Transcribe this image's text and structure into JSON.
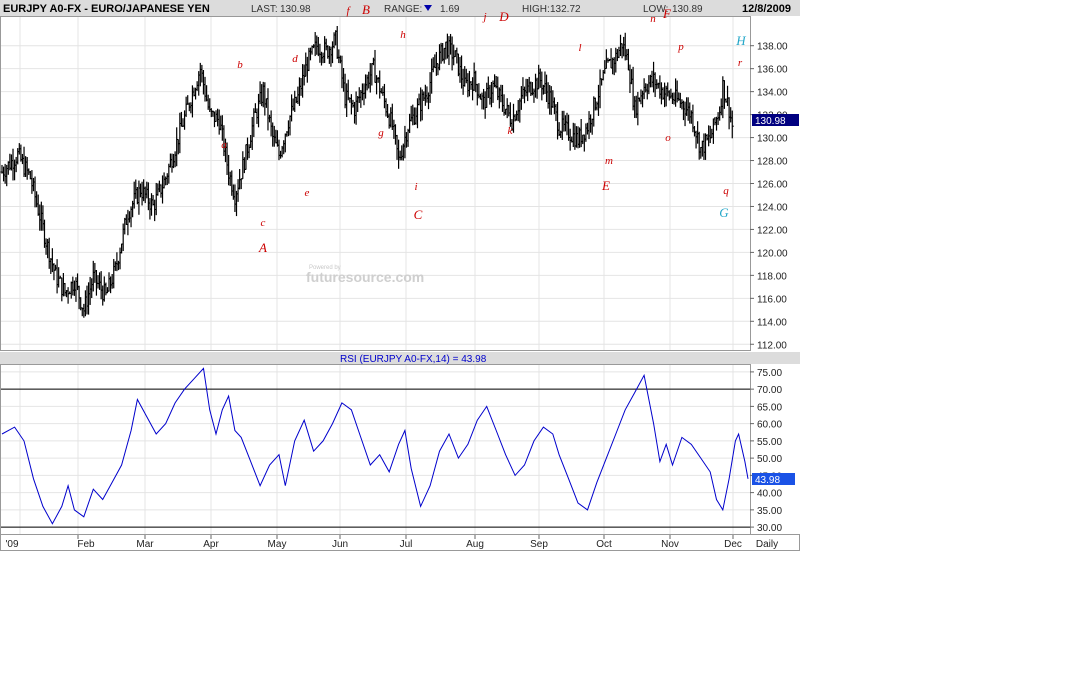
{
  "header": {
    "symbol": "EURJPY A0-FX - EURO/JAPANESE YEN",
    "last_label": "LAST:",
    "last_value": "130.98",
    "range_label": "RANGE:",
    "range_value": "1.69",
    "high_label": "HIGH:",
    "high_value": "132.72",
    "low_label": "LOW:",
    "low_value": "130.89",
    "date": "12/8/2009"
  },
  "watermark": "futuresource.com",
  "watermark_small": "Powered by",
  "rsi_title": "RSI (EURJPY A0-FX,14) = 43.98",
  "last_price_tag": "130.98",
  "rsi_tag": "43.98",
  "colors": {
    "header_bg": "#dcdcdc",
    "price_bars": "#000000",
    "rsi_line": "#0000cc",
    "tag_bg": "#000080",
    "rsi_tag_bg": "#1a52e6",
    "wave_red": "#cc0000",
    "wave_blue": "#22a6c8",
    "grid": "#dddddd"
  },
  "chart_data": [
    {
      "type": "ohlc",
      "title": "EURJPY A0-FX - EURO/JAPANESE YEN",
      "xlabel": "",
      "ylabel": "",
      "ylim": [
        111.5,
        140.5
      ],
      "y_ticks": [
        "112.00",
        "114.00",
        "116.00",
        "118.00",
        "120.00",
        "122.00",
        "124.00",
        "126.00",
        "128.00",
        "130.00",
        "132.00",
        "134.00",
        "136.00",
        "138.00"
      ],
      "x_ticks": [
        "'09",
        "Feb",
        "Mar",
        "Apr",
        "May",
        "Jun",
        "Jul",
        "Aug",
        "Sep",
        "Oct",
        "Nov",
        "Dec",
        "Daily"
      ],
      "grid": true,
      "series_close_path": [
        {
          "t": 0,
          "v": 127.0
        },
        {
          "t": 5,
          "v": 128.5
        },
        {
          "t": 9,
          "v": 126.5
        },
        {
          "t": 14,
          "v": 121
        },
        {
          "t": 17,
          "v": 118
        },
        {
          "t": 20,
          "v": 116.5
        },
        {
          "t": 23,
          "v": 117.5
        },
        {
          "t": 26,
          "v": 115.0
        },
        {
          "t": 29,
          "v": 117.8
        },
        {
          "t": 33,
          "v": 116.2
        },
        {
          "t": 36,
          "v": 118.5
        },
        {
          "t": 40,
          "v": 123.5
        },
        {
          "t": 44,
          "v": 125.5
        },
        {
          "t": 48,
          "v": 124.0
        },
        {
          "t": 52,
          "v": 126.5
        },
        {
          "t": 56,
          "v": 130.0
        },
        {
          "t": 60,
          "v": 133.5
        },
        {
          "t": 63,
          "v": 136.0
        },
        {
          "t": 66,
          "v": 132.0
        },
        {
          "t": 69,
          "v": 131.5
        },
        {
          "t": 72,
          "v": 127.0
        },
        {
          "t": 74,
          "v": 125.0
        },
        {
          "t": 77,
          "v": 128.0
        },
        {
          "t": 80,
          "v": 131.5
        },
        {
          "t": 83,
          "v": 134.0
        },
        {
          "t": 86,
          "v": 130.0
        },
        {
          "t": 88,
          "v": 128.5
        },
        {
          "t": 91,
          "v": 131.5
        },
        {
          "t": 94,
          "v": 133.5
        },
        {
          "t": 97,
          "v": 136.5
        },
        {
          "t": 100,
          "v": 138.0
        },
        {
          "t": 103,
          "v": 137.5
        },
        {
          "t": 106,
          "v": 138.5
        },
        {
          "t": 109,
          "v": 133.5
        },
        {
          "t": 112,
          "v": 132.5
        },
        {
          "t": 115,
          "v": 134.5
        },
        {
          "t": 118,
          "v": 136.0
        },
        {
          "t": 121,
          "v": 133.5
        },
        {
          "t": 124,
          "v": 131.0
        },
        {
          "t": 126,
          "v": 128.0
        },
        {
          "t": 129,
          "v": 131.0
        },
        {
          "t": 132,
          "v": 132.5
        },
        {
          "t": 135,
          "v": 134.0
        },
        {
          "t": 138,
          "v": 136.5
        },
        {
          "t": 141,
          "v": 138.0
        },
        {
          "t": 144,
          "v": 137.0
        },
        {
          "t": 147,
          "v": 134.5
        },
        {
          "t": 150,
          "v": 135.0
        },
        {
          "t": 153,
          "v": 133.0
        },
        {
          "t": 156,
          "v": 134.5
        },
        {
          "t": 159,
          "v": 133.0
        },
        {
          "t": 162,
          "v": 131.5
        },
        {
          "t": 165,
          "v": 133.5
        },
        {
          "t": 168,
          "v": 134.5
        },
        {
          "t": 171,
          "v": 135.0
        },
        {
          "t": 174,
          "v": 133.5
        },
        {
          "t": 177,
          "v": 131.0
        },
        {
          "t": 180,
          "v": 130.5
        },
        {
          "t": 183,
          "v": 129.8
        },
        {
          "t": 186,
          "v": 131.0
        },
        {
          "t": 189,
          "v": 133.5
        },
        {
          "t": 192,
          "v": 136.0
        },
        {
          "t": 195,
          "v": 137.0
        },
        {
          "t": 197,
          "v": 138.2
        },
        {
          "t": 199,
          "v": 136.5
        },
        {
          "t": 201,
          "v": 132.5
        },
        {
          "t": 204,
          "v": 134.5
        },
        {
          "t": 207,
          "v": 135.0
        },
        {
          "t": 210,
          "v": 134.0
        },
        {
          "t": 213,
          "v": 133.5
        },
        {
          "t": 216,
          "v": 133.0
        },
        {
          "t": 219,
          "v": 132.0
        },
        {
          "t": 222,
          "v": 129.0
        },
        {
          "t": 225,
          "v": 130.0
        },
        {
          "t": 228,
          "v": 132.5
        },
        {
          "t": 229,
          "v": 134.5
        },
        {
          "t": 231,
          "v": 132.5
        },
        {
          "t": 232,
          "v": 131.0
        }
      ],
      "wave_labels": [
        {
          "label": "a",
          "color": "red"
        },
        {
          "label": "b",
          "color": "red"
        },
        {
          "label": "c",
          "color": "red"
        },
        {
          "label": "A",
          "color": "red"
        },
        {
          "label": "d",
          "color": "red"
        },
        {
          "label": "e",
          "color": "red"
        },
        {
          "label": "f",
          "color": "red"
        },
        {
          "label": "B",
          "color": "red"
        },
        {
          "label": "g",
          "color": "red"
        },
        {
          "label": "h",
          "color": "red"
        },
        {
          "label": "i",
          "color": "red"
        },
        {
          "label": "C",
          "color": "red"
        },
        {
          "label": "j",
          "color": "red"
        },
        {
          "label": "D",
          "color": "red"
        },
        {
          "label": "k",
          "color": "red"
        },
        {
          "label": "l",
          "color": "red"
        },
        {
          "label": "m",
          "color": "red"
        },
        {
          "label": "E",
          "color": "red"
        },
        {
          "label": "n",
          "color": "red"
        },
        {
          "label": "F",
          "color": "red"
        },
        {
          "label": "o",
          "color": "red"
        },
        {
          "label": "p",
          "color": "red"
        },
        {
          "label": "q",
          "color": "red"
        },
        {
          "label": "r",
          "color": "red"
        },
        {
          "label": "G",
          "color": "blue"
        },
        {
          "label": "H",
          "color": "blue"
        }
      ]
    },
    {
      "type": "line",
      "title": "RSI (EURJPY A0-FX,14) = 43.98",
      "xlabel": "",
      "ylabel": "",
      "ylim": [
        28,
        77
      ],
      "y_ticks": [
        "30.00",
        "35.00",
        "40.00",
        "45.00",
        "50.00",
        "55.00",
        "60.00",
        "65.00",
        "70.00",
        "75.00"
      ],
      "reference_lines": [
        70,
        30
      ],
      "series": [
        {
          "values": [
            {
              "t": 0,
              "v": 57
            },
            {
              "t": 4,
              "v": 59
            },
            {
              "t": 7,
              "v": 55
            },
            {
              "t": 10,
              "v": 44
            },
            {
              "t": 13,
              "v": 36
            },
            {
              "t": 16,
              "v": 31
            },
            {
              "t": 19,
              "v": 36
            },
            {
              "t": 21,
              "v": 42
            },
            {
              "t": 23,
              "v": 35
            },
            {
              "t": 26,
              "v": 33
            },
            {
              "t": 29,
              "v": 41
            },
            {
              "t": 32,
              "v": 38
            },
            {
              "t": 35,
              "v": 43
            },
            {
              "t": 38,
              "v": 48
            },
            {
              "t": 41,
              "v": 58
            },
            {
              "t": 43,
              "v": 67
            },
            {
              "t": 46,
              "v": 62
            },
            {
              "t": 49,
              "v": 57
            },
            {
              "t": 52,
              "v": 60
            },
            {
              "t": 55,
              "v": 66
            },
            {
              "t": 58,
              "v": 70
            },
            {
              "t": 61,
              "v": 73
            },
            {
              "t": 64,
              "v": 76
            },
            {
              "t": 66,
              "v": 64
            },
            {
              "t": 68,
              "v": 57
            },
            {
              "t": 70,
              "v": 64
            },
            {
              "t": 72,
              "v": 68
            },
            {
              "t": 74,
              "v": 58
            },
            {
              "t": 76,
              "v": 56
            },
            {
              "t": 79,
              "v": 49
            },
            {
              "t": 82,
              "v": 42
            },
            {
              "t": 85,
              "v": 48
            },
            {
              "t": 88,
              "v": 51
            },
            {
              "t": 90,
              "v": 42
            },
            {
              "t": 93,
              "v": 55
            },
            {
              "t": 96,
              "v": 61
            },
            {
              "t": 99,
              "v": 52
            },
            {
              "t": 102,
              "v": 55
            },
            {
              "t": 105,
              "v": 60
            },
            {
              "t": 108,
              "v": 66
            },
            {
              "t": 111,
              "v": 64
            },
            {
              "t": 114,
              "v": 56
            },
            {
              "t": 117,
              "v": 48
            },
            {
              "t": 120,
              "v": 51
            },
            {
              "t": 123,
              "v": 46
            },
            {
              "t": 126,
              "v": 54
            },
            {
              "t": 128,
              "v": 58
            },
            {
              "t": 130,
              "v": 47
            },
            {
              "t": 133,
              "v": 36
            },
            {
              "t": 136,
              "v": 42
            },
            {
              "t": 139,
              "v": 52
            },
            {
              "t": 142,
              "v": 57
            },
            {
              "t": 145,
              "v": 50
            },
            {
              "t": 148,
              "v": 54
            },
            {
              "t": 151,
              "v": 61
            },
            {
              "t": 154,
              "v": 65
            },
            {
              "t": 157,
              "v": 58
            },
            {
              "t": 160,
              "v": 51
            },
            {
              "t": 163,
              "v": 45
            },
            {
              "t": 166,
              "v": 48
            },
            {
              "t": 169,
              "v": 55
            },
            {
              "t": 172,
              "v": 59
            },
            {
              "t": 175,
              "v": 57
            },
            {
              "t": 177,
              "v": 51
            },
            {
              "t": 180,
              "v": 44
            },
            {
              "t": 183,
              "v": 37
            },
            {
              "t": 186,
              "v": 35
            },
            {
              "t": 189,
              "v": 43
            },
            {
              "t": 192,
              "v": 50
            },
            {
              "t": 195,
              "v": 57
            },
            {
              "t": 198,
              "v": 64
            },
            {
              "t": 201,
              "v": 69
            },
            {
              "t": 204,
              "v": 74
            },
            {
              "t": 207,
              "v": 60
            },
            {
              "t": 209,
              "v": 49
            },
            {
              "t": 211,
              "v": 54
            },
            {
              "t": 213,
              "v": 48
            },
            {
              "t": 216,
              "v": 56
            },
            {
              "t": 219,
              "v": 54
            },
            {
              "t": 222,
              "v": 50
            },
            {
              "t": 225,
              "v": 46
            },
            {
              "t": 227,
              "v": 38
            },
            {
              "t": 229,
              "v": 35
            },
            {
              "t": 231,
              "v": 44
            },
            {
              "t": 233,
              "v": 55
            },
            {
              "t": 234,
              "v": 57
            },
            {
              "t": 236,
              "v": 49
            },
            {
              "t": 237,
              "v": 44
            }
          ]
        }
      ]
    }
  ]
}
